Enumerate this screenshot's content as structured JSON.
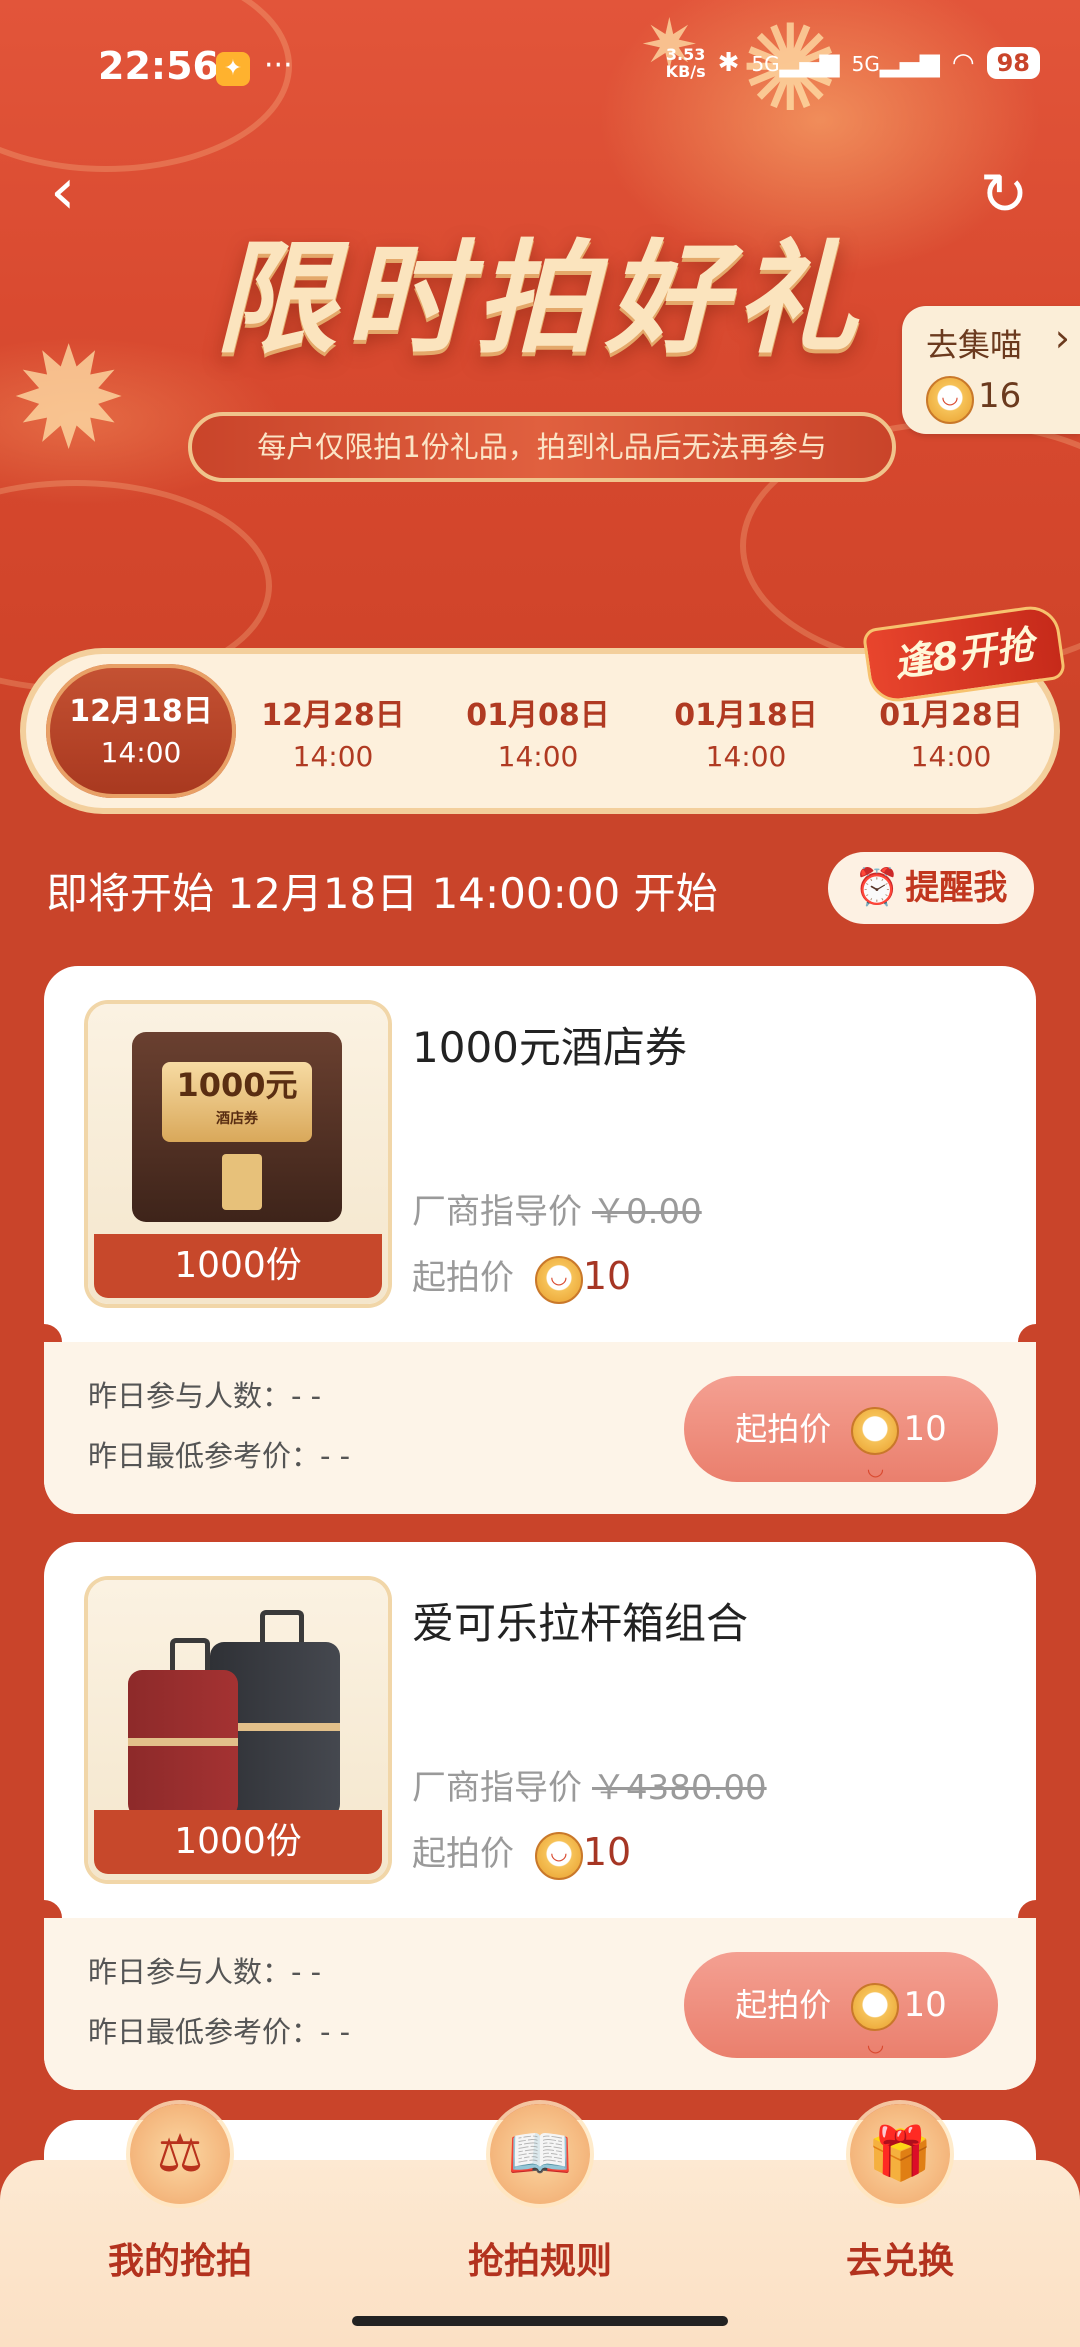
{
  "status_bar": {
    "time": "22:56",
    "net_speed_value": "3.53",
    "net_speed_unit": "KB/s",
    "signal1": "5G",
    "signal2": "5G",
    "battery": "98"
  },
  "header": {
    "title": "限时拍好礼",
    "subtitle": "每户仅限拍1份礼品，拍到礼品后无法再参与",
    "collect_label": "去集喵",
    "collect_count": "16"
  },
  "promo_tag": "逢8开抢",
  "date_tabs": [
    {
      "date": "12月18日",
      "time": "14:00",
      "active": true
    },
    {
      "date": "12月28日",
      "time": "14:00"
    },
    {
      "date": "01月08日",
      "time": "14:00"
    },
    {
      "date": "01月18日",
      "time": "14:00"
    },
    {
      "date": "01月28日",
      "time": "14:00"
    }
  ],
  "countdown": {
    "text": "即将开始 12月18日 14:00:00 开始",
    "remind_label": "提醒我"
  },
  "products": [
    {
      "name": "1000元酒店券",
      "quantity": "1000份",
      "thumb_amount": "1000元",
      "thumb_label": "酒店券",
      "msrp_label": "厂商指导价",
      "msrp_value": "￥0.00",
      "start_label": "起拍价",
      "start_value": "10",
      "participants_label": "昨日参与人数：- -",
      "lowest_label": "昨日最低参考价：- -",
      "bid_label": "起拍价",
      "bid_value": "10"
    },
    {
      "name": "爱可乐拉杆箱组合",
      "quantity": "1000份",
      "msrp_label": "厂商指导价",
      "msrp_value": "￥4380.00",
      "start_label": "起拍价",
      "start_value": "10",
      "participants_label": "昨日参与人数：- -",
      "lowest_label": "昨日最低参考价：- -",
      "bid_label": "起拍价",
      "bid_value": "10"
    }
  ],
  "bottom_nav": [
    {
      "label": "我的抢拍",
      "icon": "gavel-icon"
    },
    {
      "label": "抢拍规则",
      "icon": "book-icon"
    },
    {
      "label": "去兑换",
      "icon": "gift-icon"
    }
  ]
}
